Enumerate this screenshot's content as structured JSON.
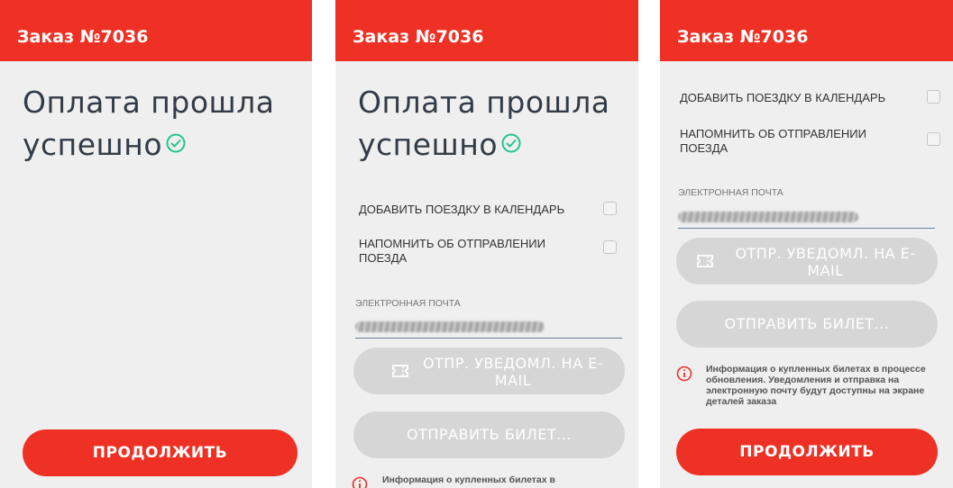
{
  "order_title": "Заказ №7036",
  "success_title_line1": "Оплата прошла",
  "success_title_line2": "успешно",
  "options": {
    "add_to_calendar": "ДОБАВИТЬ ПОЕЗДКУ В КАЛЕНДАРЬ",
    "remind_departure": "НАПОМНИТЬ ОБ ОТПРАВЛЕНИИ ПОЕЗДА"
  },
  "email": {
    "label": "ЭЛЕКТРОННАЯ ПОЧТА"
  },
  "buttons": {
    "send_notification": "ОТПР. УВЕДОМЛ. НА E-MAIL",
    "send_ticket": "ОТПРАВИТЬ БИЛЕТ...",
    "continue": "ПРОДОЛЖИТЬ"
  },
  "info_text": "Информация о купленных билетах в процессе обновления. Уведомления и отправка на электронную почту будут доступны на экране деталей заказа",
  "info_text_partial": "Информация о купленных билетах в",
  "colors": {
    "header": "#ee3124",
    "accent_check": "#22c48a",
    "disabled_button": "#d6d6d6"
  },
  "icons": [
    "check-circle-icon",
    "ticket-icon",
    "info-icon"
  ]
}
